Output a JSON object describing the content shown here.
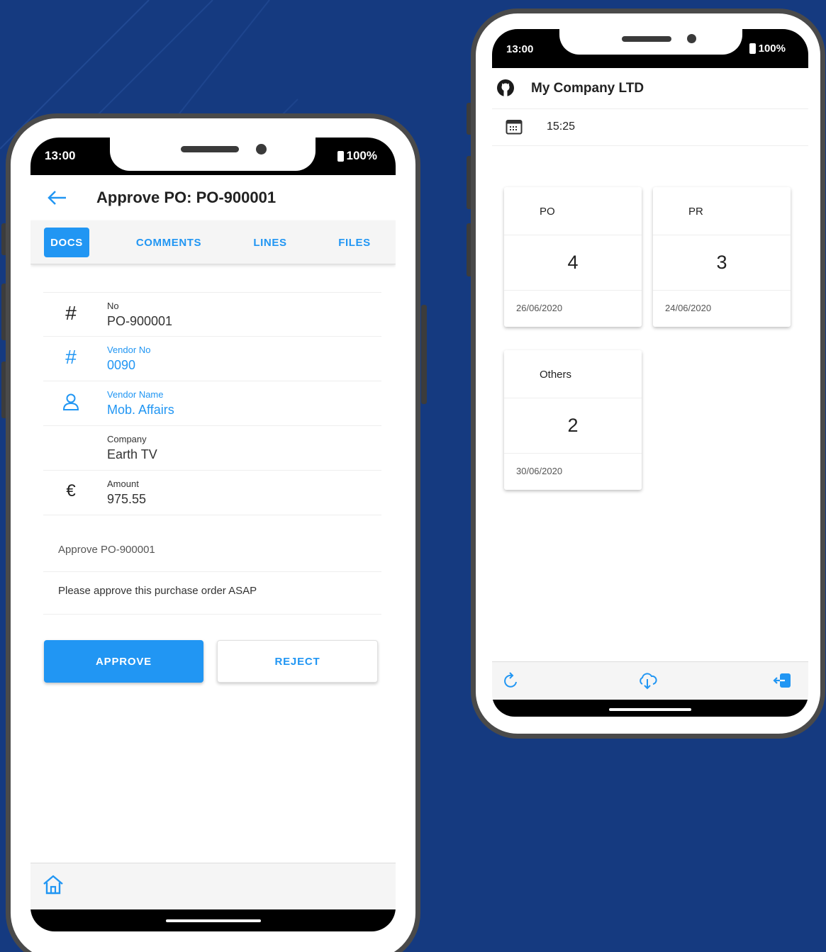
{
  "colors": {
    "background": "#153a80",
    "accent": "#2196f3",
    "frame": "#4a4a4a"
  },
  "left_phone": {
    "status": {
      "time": "13:00",
      "battery": "100%"
    },
    "appbar": {
      "back_icon": "arrow-left-icon",
      "title": "Approve PO: PO-900001"
    },
    "tabs": [
      {
        "label": "DOCS",
        "active": true
      },
      {
        "label": "COMMENTS",
        "active": false
      },
      {
        "label": "LINES",
        "active": false
      },
      {
        "label": "FILES",
        "active": false
      }
    ],
    "details": [
      {
        "icon": "hash-icon",
        "label": "No",
        "value": "PO-900001",
        "link": false
      },
      {
        "icon": "hash-icon",
        "label": "Vendor No",
        "value": "0090",
        "link": true
      },
      {
        "icon": "person-icon",
        "label": "Vendor Name",
        "value": "Mob. Affairs",
        "link": true
      },
      {
        "icon": "",
        "label": "Company",
        "value": "Earth TV",
        "link": false
      },
      {
        "icon": "euro-icon",
        "label": "Amount",
        "value": "975.55",
        "link": false
      }
    ],
    "subject": "Approve PO-900001",
    "message": "Please approve this purchase order ASAP",
    "buttons": {
      "approve": "APPROVE",
      "reject": "REJECT"
    },
    "bottom_nav": {
      "home_icon": "home-icon"
    }
  },
  "right_phone": {
    "status": {
      "time": "13:00",
      "battery": "100%"
    },
    "company": {
      "icon": "github-icon",
      "name": "My Company LTD"
    },
    "time_row": {
      "icon": "calendar-icon",
      "value": "15:25"
    },
    "cards": [
      {
        "title": "PO",
        "count": "4",
        "date": "26/06/2020"
      },
      {
        "title": "PR",
        "count": "3",
        "date": "24/06/2020"
      },
      {
        "title": "Others",
        "count": "2",
        "date": "30/06/2020"
      }
    ],
    "bottom_nav": {
      "refresh_icon": "refresh-icon",
      "download_icon": "cloud-download-icon",
      "logout_icon": "logout-icon"
    }
  }
}
